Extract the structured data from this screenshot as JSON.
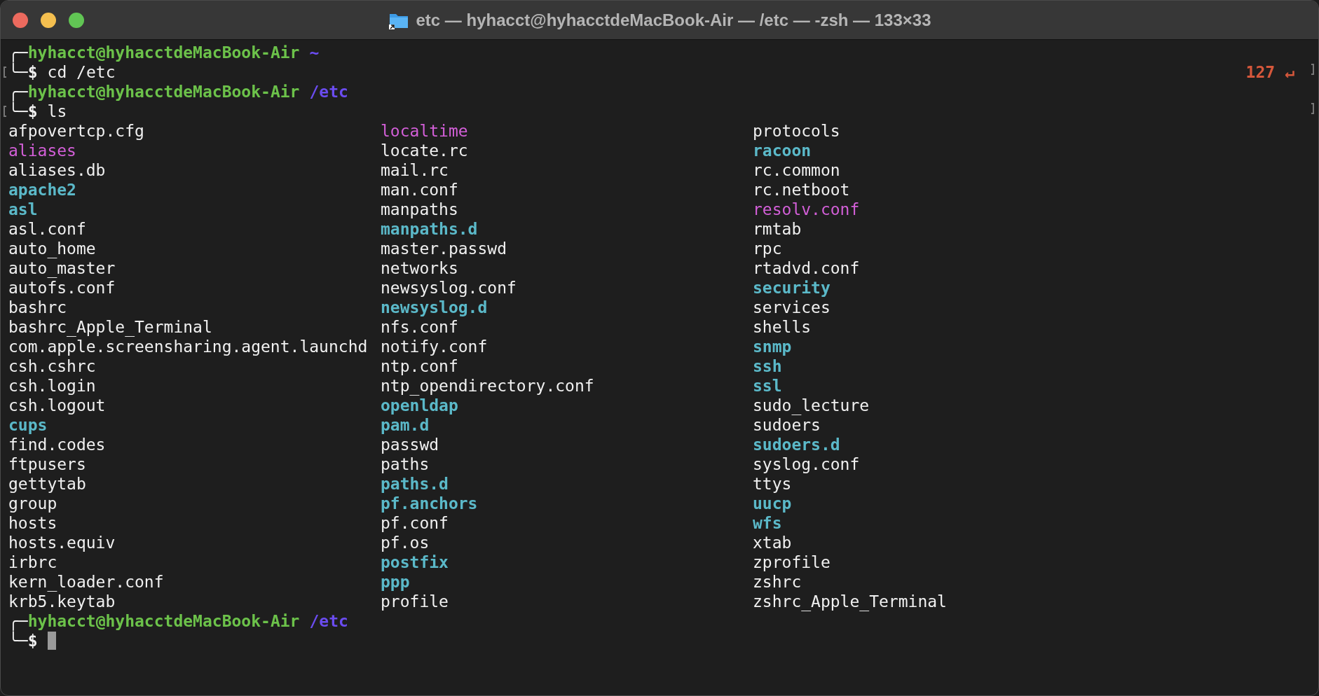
{
  "window": {
    "title": "etc — hyhacct@hyhacctdeMacBook-Air — /etc — -zsh — 133×33"
  },
  "session": [
    {
      "kind": "prompt",
      "corner_top": "╭─",
      "user_host": "hyhacct@hyhacctdeMacBook-Air",
      "cwd": "~",
      "corner_bottom": "╰─",
      "symbol": "$",
      "command": "cd /etc",
      "marked": true,
      "status": "127",
      "status_icon": "↵",
      "cursor": false
    },
    {
      "kind": "prompt",
      "corner_top": "╭─",
      "user_host": "hyhacct@hyhacctdeMacBook-Air",
      "cwd": "/etc",
      "corner_bottom": "╰─",
      "symbol": "$",
      "command": "ls",
      "marked": true,
      "cursor": false
    },
    {
      "kind": "listing",
      "columns": [
        [
          {
            "name": "afpovertcp.cfg",
            "kind": "file"
          },
          {
            "name": "aliases",
            "kind": "link"
          },
          {
            "name": "aliases.db",
            "kind": "file"
          },
          {
            "name": "apache2",
            "kind": "dir"
          },
          {
            "name": "asl",
            "kind": "dir"
          },
          {
            "name": "asl.conf",
            "kind": "file"
          },
          {
            "name": "auto_home",
            "kind": "file"
          },
          {
            "name": "auto_master",
            "kind": "file"
          },
          {
            "name": "autofs.conf",
            "kind": "file"
          },
          {
            "name": "bashrc",
            "kind": "file"
          },
          {
            "name": "bashrc_Apple_Terminal",
            "kind": "file"
          },
          {
            "name": "com.apple.screensharing.agent.launchd",
            "kind": "file"
          },
          {
            "name": "csh.cshrc",
            "kind": "file"
          },
          {
            "name": "csh.login",
            "kind": "file"
          },
          {
            "name": "csh.logout",
            "kind": "file"
          },
          {
            "name": "cups",
            "kind": "dir"
          },
          {
            "name": "find.codes",
            "kind": "file"
          },
          {
            "name": "ftpusers",
            "kind": "file"
          },
          {
            "name": "gettytab",
            "kind": "file"
          },
          {
            "name": "group",
            "kind": "file"
          },
          {
            "name": "hosts",
            "kind": "file"
          },
          {
            "name": "hosts.equiv",
            "kind": "file"
          },
          {
            "name": "irbrc",
            "kind": "file"
          },
          {
            "name": "kern_loader.conf",
            "kind": "file"
          },
          {
            "name": "krb5.keytab",
            "kind": "file"
          }
        ],
        [
          {
            "name": "localtime",
            "kind": "link"
          },
          {
            "name": "locate.rc",
            "kind": "file"
          },
          {
            "name": "mail.rc",
            "kind": "file"
          },
          {
            "name": "man.conf",
            "kind": "file"
          },
          {
            "name": "manpaths",
            "kind": "file"
          },
          {
            "name": "manpaths.d",
            "kind": "dir"
          },
          {
            "name": "master.passwd",
            "kind": "file"
          },
          {
            "name": "networks",
            "kind": "file"
          },
          {
            "name": "newsyslog.conf",
            "kind": "file"
          },
          {
            "name": "newsyslog.d",
            "kind": "dir"
          },
          {
            "name": "nfs.conf",
            "kind": "file"
          },
          {
            "name": "notify.conf",
            "kind": "file"
          },
          {
            "name": "ntp.conf",
            "kind": "file"
          },
          {
            "name": "ntp_opendirectory.conf",
            "kind": "file"
          },
          {
            "name": "openldap",
            "kind": "dir"
          },
          {
            "name": "pam.d",
            "kind": "dir"
          },
          {
            "name": "passwd",
            "kind": "file"
          },
          {
            "name": "paths",
            "kind": "file"
          },
          {
            "name": "paths.d",
            "kind": "dir"
          },
          {
            "name": "pf.anchors",
            "kind": "dir"
          },
          {
            "name": "pf.conf",
            "kind": "file"
          },
          {
            "name": "pf.os",
            "kind": "file"
          },
          {
            "name": "postfix",
            "kind": "dir"
          },
          {
            "name": "ppp",
            "kind": "dir"
          },
          {
            "name": "profile",
            "kind": "file"
          }
        ],
        [
          {
            "name": "protocols",
            "kind": "file"
          },
          {
            "name": "racoon",
            "kind": "dir"
          },
          {
            "name": "rc.common",
            "kind": "file"
          },
          {
            "name": "rc.netboot",
            "kind": "file"
          },
          {
            "name": "resolv.conf",
            "kind": "link"
          },
          {
            "name": "rmtab",
            "kind": "file"
          },
          {
            "name": "rpc",
            "kind": "file"
          },
          {
            "name": "rtadvd.conf",
            "kind": "file"
          },
          {
            "name": "security",
            "kind": "dir"
          },
          {
            "name": "services",
            "kind": "file"
          },
          {
            "name": "shells",
            "kind": "file"
          },
          {
            "name": "snmp",
            "kind": "dir"
          },
          {
            "name": "ssh",
            "kind": "dir"
          },
          {
            "name": "ssl",
            "kind": "dir"
          },
          {
            "name": "sudo_lecture",
            "kind": "file"
          },
          {
            "name": "sudoers",
            "kind": "file"
          },
          {
            "name": "sudoers.d",
            "kind": "dir"
          },
          {
            "name": "syslog.conf",
            "kind": "file"
          },
          {
            "name": "ttys",
            "kind": "file"
          },
          {
            "name": "uucp",
            "kind": "dir"
          },
          {
            "name": "wfs",
            "kind": "dir"
          },
          {
            "name": "xtab",
            "kind": "file"
          },
          {
            "name": "zprofile",
            "kind": "file"
          },
          {
            "name": "zshrc",
            "kind": "file"
          },
          {
            "name": "zshrc_Apple_Terminal",
            "kind": "file"
          }
        ]
      ]
    },
    {
      "kind": "prompt",
      "corner_top": "╭─",
      "user_host": "hyhacct@hyhacctdeMacBook-Air",
      "cwd": "/etc",
      "corner_bottom": "╰─",
      "symbol": "$",
      "marked": false,
      "cursor": true
    }
  ]
}
